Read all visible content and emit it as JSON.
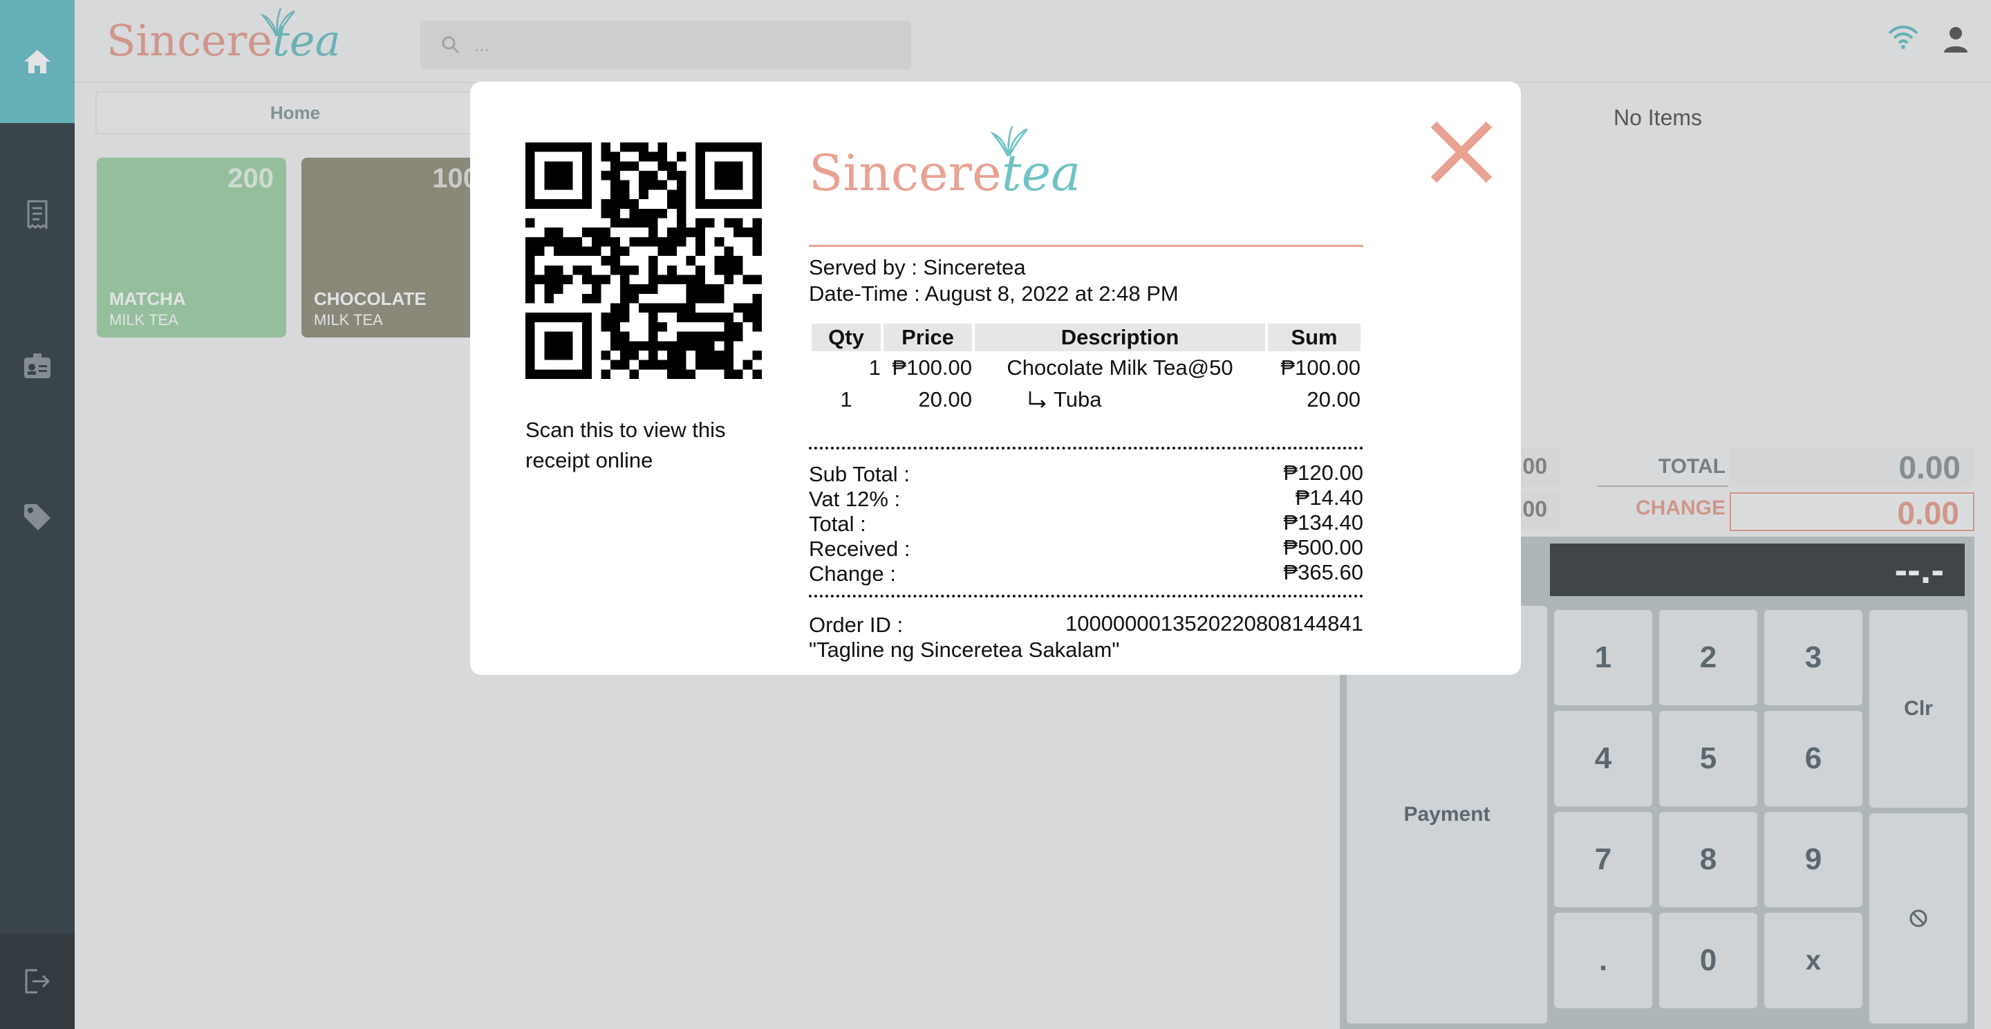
{
  "app": {
    "logo_part1": "Sincere",
    "logo_part2": "tea",
    "brand_colors": {
      "primary": "#e9a192",
      "accent": "#6fc3c7",
      "sidebar": "#343d45"
    }
  },
  "sidebar": {
    "items": [
      {
        "icon": "home-icon"
      },
      {
        "icon": "receipt-icon"
      },
      {
        "icon": "id-badge-icon"
      },
      {
        "icon": "tag-icon"
      },
      {
        "icon": "logout-icon"
      }
    ]
  },
  "header": {
    "search_placeholder": "...",
    "icons": [
      "wifi-icon",
      "user-icon"
    ]
  },
  "main": {
    "tab_home": "Home",
    "products": [
      {
        "qty": "200",
        "name": "MATCHA",
        "sub": "MILK TEA",
        "color": "#a3d4a8"
      },
      {
        "qty": "100",
        "name": "CHOCOLATE",
        "sub": "MILK TEA",
        "color": "#94907d"
      }
    ]
  },
  "order_panel": {
    "no_items": "No Items",
    "left_vals": [
      ".00",
      ".00"
    ],
    "total_label": "TOTAL",
    "total_value": "0.00",
    "change_label": "CHANGE",
    "change_value": "0.00",
    "display": "--.-",
    "keys": [
      "1",
      "2",
      "3",
      "4",
      "5",
      "6",
      "7",
      "8",
      "9",
      ".",
      "0",
      "x"
    ],
    "clr": "Clr",
    "payment": "Payment"
  },
  "receipt_modal": {
    "scan_text": "Scan this to view this receipt online",
    "logo_part1": "Sincere",
    "logo_part2": "tea",
    "served_by": "Served by : Sinceretea",
    "date_time": "Date-Time : August 8, 2022 at 2:48 PM",
    "columns": [
      "Qty",
      "Price",
      "Description",
      "Sum"
    ],
    "rows": [
      {
        "qty": "1",
        "price": "₱100.00",
        "description": "Chocolate Milk Tea@50",
        "sum": "₱100.00"
      },
      {
        "qty": "1",
        "price": "20.00",
        "description": "Tuba",
        "sum": "20.00"
      }
    ],
    "summary": [
      {
        "label": "Sub Total :",
        "value": "₱120.00"
      },
      {
        "label": "Vat 12% :",
        "value": "₱14.40"
      },
      {
        "label": "Total :",
        "value": "₱134.40"
      },
      {
        "label": "Received :",
        "value": "₱500.00"
      },
      {
        "label": "Change :",
        "value": "₱365.60"
      }
    ],
    "order_id_label": "Order ID :",
    "order_id_value": "100000001352022080814484​1",
    "tagline": "\"Tagline ng Sinceretea Sakalam\""
  }
}
